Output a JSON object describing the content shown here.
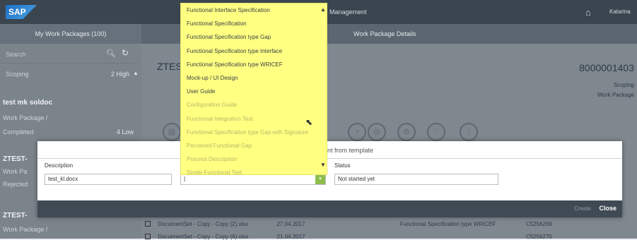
{
  "shell": {
    "logo": "SAP",
    "title": "Management",
    "user": "Katarina"
  },
  "subheader": {
    "left": "My Work Packages (100)",
    "right": "Work Package Details"
  },
  "master": {
    "search_placeholder": "Search",
    "items": [
      {
        "label": "Scoping",
        "priority": "2 High"
      },
      {
        "title": "test mk soldoc",
        "subtitle": "Work Package /",
        "status": "Completed",
        "priority": "4 Low"
      },
      {
        "title": "ZTEST-",
        "subtitle": "Work Pa",
        "status": "Rejected"
      },
      {
        "title": "ZTEST-",
        "subtitle": "Work Package /"
      }
    ]
  },
  "detail": {
    "title": "ZTES",
    "number": "8000001403",
    "sub1": "Scoping",
    "sub2": "Work Package"
  },
  "dialog": {
    "title": "nt from template",
    "description_label": "Description",
    "description_value": "test_kl.docx",
    "template_value": "|",
    "status_label": "Status",
    "status_value": "Not started yet",
    "create_label": "Create",
    "close_label": "Close"
  },
  "table_rows": [
    {
      "name": "DocumentSet - Copy - Copy (2).xlsx",
      "date": "27.04.2017",
      "type": "Functional Specification type WRICEF",
      "id": "C5256269"
    },
    {
      "name": "DocumentSet - Copy - Copy (6).xlsx",
      "date": "21.04.2017",
      "type": "",
      "id": "C5256270"
    }
  ],
  "dropdown": {
    "items": [
      "Functional Interface Specification",
      "Functional Specification",
      "Functional Specification type Gap",
      "Functional Specification type Interface",
      "Functional Specification type WRICEF",
      "Mock-up / UI Design",
      "User Guide",
      "Configuration Guide",
      "Functional Integration Test",
      "Functional Specification type Gap with Signature",
      "Perceived Functional Gap",
      "Process Description",
      "Single Functional Test"
    ]
  }
}
